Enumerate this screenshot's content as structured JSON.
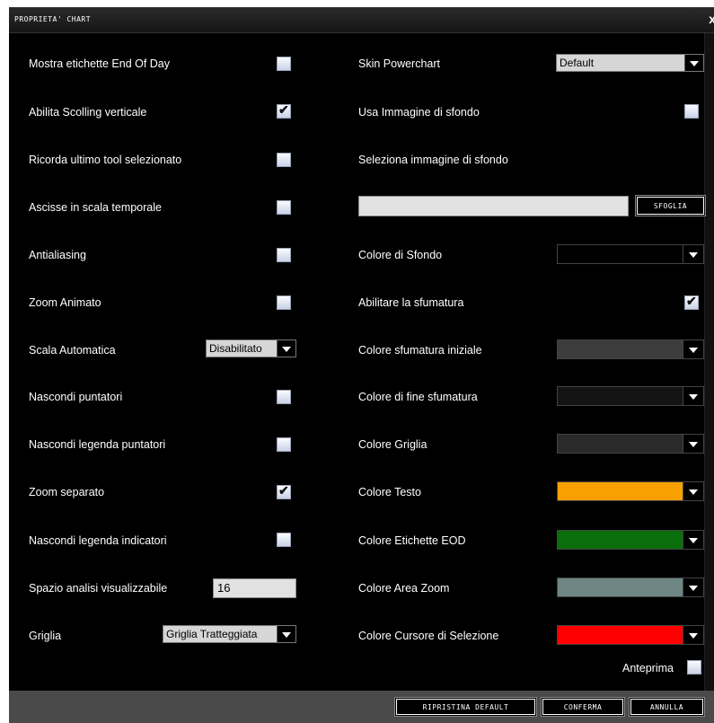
{
  "window": {
    "title": "PROPRIETA' CHART",
    "close_glyph": "x"
  },
  "left": {
    "end_of_day_label": "Mostra etichette End Of Day",
    "end_of_day_checked": false,
    "vscroll_label": "Abilita Scolling verticale",
    "vscroll_checked": true,
    "last_tool_label": "Ricorda ultimo tool selezionato",
    "last_tool_checked": false,
    "time_axis_label": "Ascisse in scala temporale",
    "time_axis_checked": false,
    "antialias_label": "Antialiasing",
    "antialias_checked": false,
    "zoom_anim_label": "Zoom Animato",
    "zoom_anim_checked": false,
    "auto_scale_label": "Scala Automatica",
    "auto_scale_value": "Disabilitato",
    "hide_pointers_label": "Nascondi puntatori",
    "hide_pointers_checked": false,
    "hide_pointer_legend_label": "Nascondi legenda puntatori",
    "hide_pointer_legend_checked": false,
    "zoom_sep_label": "Zoom separato",
    "zoom_sep_checked": true,
    "hide_ind_legend_label": "Nascondi legenda indicatori",
    "hide_ind_legend_checked": false,
    "space_label": "Spazio analisi visualizzabile",
    "space_value": "16",
    "grid_label": "Griglia",
    "grid_value": "Griglia Tratteggiata"
  },
  "right": {
    "skin_label": "Skin Powerchart",
    "skin_value": "Default",
    "bg_image_label": "Usa Immagine di sfondo",
    "bg_image_checked": false,
    "select_bg_label": "Seleziona immagine di sfondo",
    "bg_path_value": "",
    "browse_label": "SFOGLIA",
    "bg_color_label": "Colore di Sfondo",
    "gradient_label": "Abilitare la sfumatura",
    "gradient_checked": true,
    "grad_start_label": "Colore sfumatura iniziale",
    "grad_end_label": "Colore di fine sfumatura",
    "grid_color_label": "Colore Griglia",
    "text_color_label": "Colore Testo",
    "eod_color_label": "Colore Etichette EOD",
    "zoom_area_color_label": "Colore Area Zoom",
    "cursor_color_label": "Colore Cursore di Selezione",
    "preview_label": "Anteprima",
    "preview_checked": false
  },
  "colors": {
    "background": "#000000",
    "grad_start": "#3c3c3c",
    "grad_end": "#141414",
    "grid": "#2a2a2a",
    "text": "#f7a000",
    "eod": "#0a6e0a",
    "zoom_area": "#6e8784",
    "cursor": "#ff0000"
  },
  "checkmark": "✔",
  "footer": {
    "reset_label": "RIPRISTINA DEFAULT",
    "confirm_label": "CONFERMA",
    "cancel_label": "ANNULLA"
  }
}
